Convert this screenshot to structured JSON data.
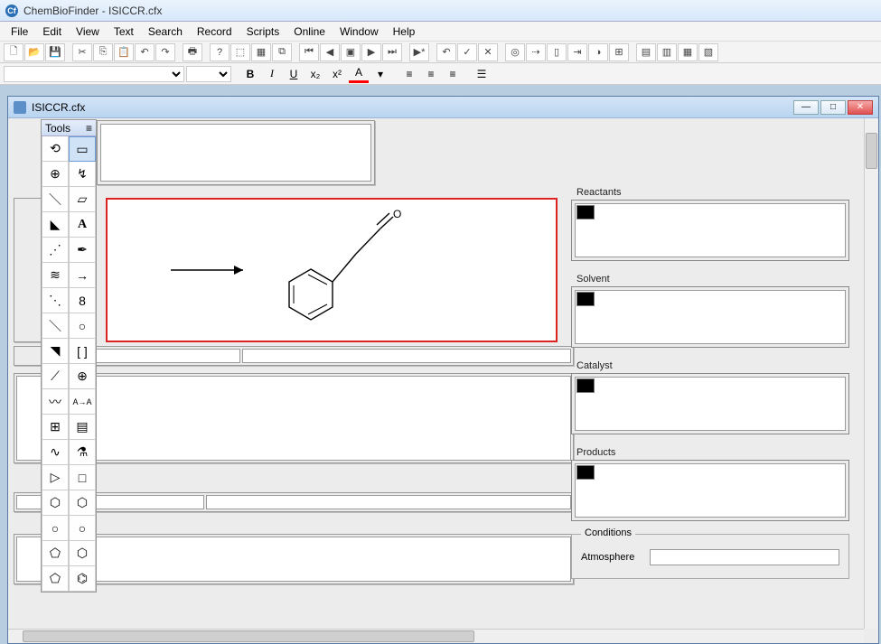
{
  "app": {
    "title": "ChemBioFinder - ISICCR.cfx",
    "icon_letter": "Cf"
  },
  "menu": [
    "File",
    "Edit",
    "View",
    "Text",
    "Search",
    "Record",
    "Scripts",
    "Online",
    "Window",
    "Help"
  ],
  "child": {
    "title": "ISICCR.cfx"
  },
  "tools_palette": {
    "title": "Tools"
  },
  "right_panel": {
    "reactants": "Reactants",
    "solvent": "Solvent",
    "catalyst": "Catalyst",
    "products": "Products",
    "conditions": "Conditions",
    "atmosphere": "Atmosphere"
  },
  "format": {
    "bold": "B",
    "italic": "I",
    "underline": "U",
    "sub": "x₂",
    "sup": "x²",
    "color": "A"
  }
}
